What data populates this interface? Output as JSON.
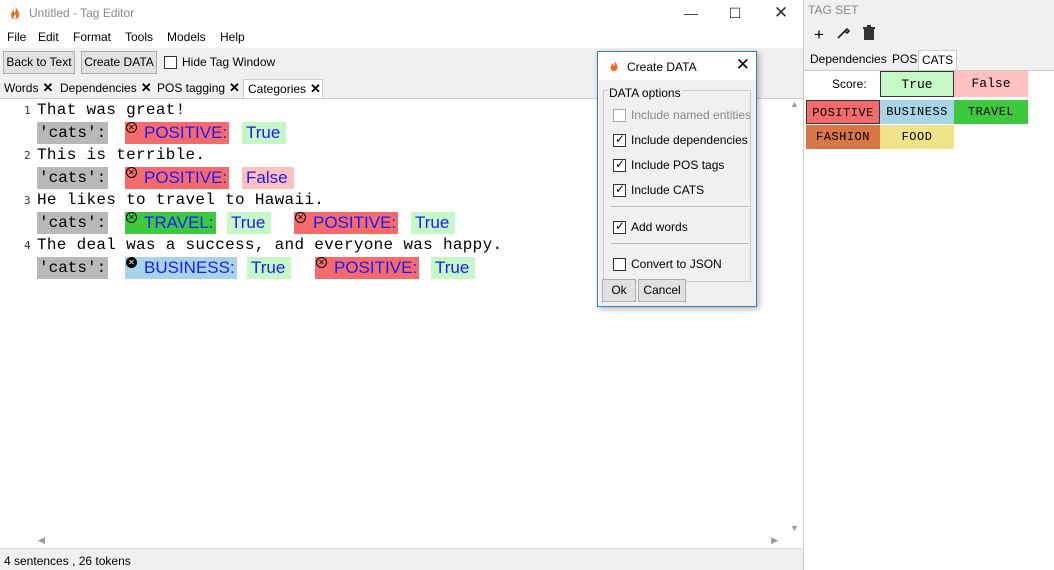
{
  "main_window": {
    "title": "Untitled - Tag Editor",
    "menu": [
      "File",
      "Edit",
      "Format",
      "Tools",
      "Models",
      "Help"
    ],
    "toolbar": {
      "back_label": "Back to Text",
      "create_label": "Create DATA",
      "hide_label": "Hide Tag Window"
    },
    "tabs": [
      "Words",
      "Dependencies",
      "POS tagging",
      "Categories"
    ],
    "sentences": [
      {
        "num": "1",
        "text": "That was great!"
      },
      {
        "num": "2",
        "text": "This is terrible."
      },
      {
        "num": "3",
        "text": "He likes to travel to Hawaii."
      },
      {
        "num": "4",
        "text": "The deal was a success, and everyone was happy."
      }
    ],
    "cats_label": "'cats':",
    "cat_tags": [
      {
        "name": "POSITIVE:",
        "value": "True"
      },
      {
        "name": "POSITIVE:",
        "value": "False"
      },
      {
        "name": "TRAVEL:",
        "value": "True"
      },
      {
        "name": "POSITIVE:",
        "value": "True"
      },
      {
        "name": "BUSINESS:",
        "value": "True"
      },
      {
        "name": "POSITIVE:",
        "value": "True"
      }
    ],
    "status": "4 sentences , 26 tokens"
  },
  "tag_set": {
    "title": "TAG SET",
    "tabs": [
      "Dependencies",
      "POS",
      "CATS"
    ],
    "score_label": "Score:",
    "score_true": "True",
    "score_false": "False",
    "categories": [
      "POSITIVE",
      "BUSINESS",
      "TRAVEL",
      "FASHION",
      "FOOD"
    ]
  },
  "dialog": {
    "title": "Create DATA",
    "group_label": "DATA options",
    "options": [
      {
        "label": "Include named entities",
        "checked": false,
        "disabled": true
      },
      {
        "label": "Include dependencies",
        "checked": true
      },
      {
        "label": "Include POS tags",
        "checked": true
      },
      {
        "label": "Include CATS",
        "checked": true
      },
      {
        "label": "Add words",
        "checked": true
      },
      {
        "label": "Convert to JSON",
        "checked": false
      }
    ],
    "ok_label": "Ok",
    "cancel_label": "Cancel"
  },
  "colors": {
    "positive": "#f56b6b",
    "business": "#a8d4e8",
    "travel": "#3dc93d",
    "fashion": "#d97645",
    "food": "#f0e38a",
    "true_bg": "#c6f7c6",
    "false_bg": "#ffc0c0"
  }
}
